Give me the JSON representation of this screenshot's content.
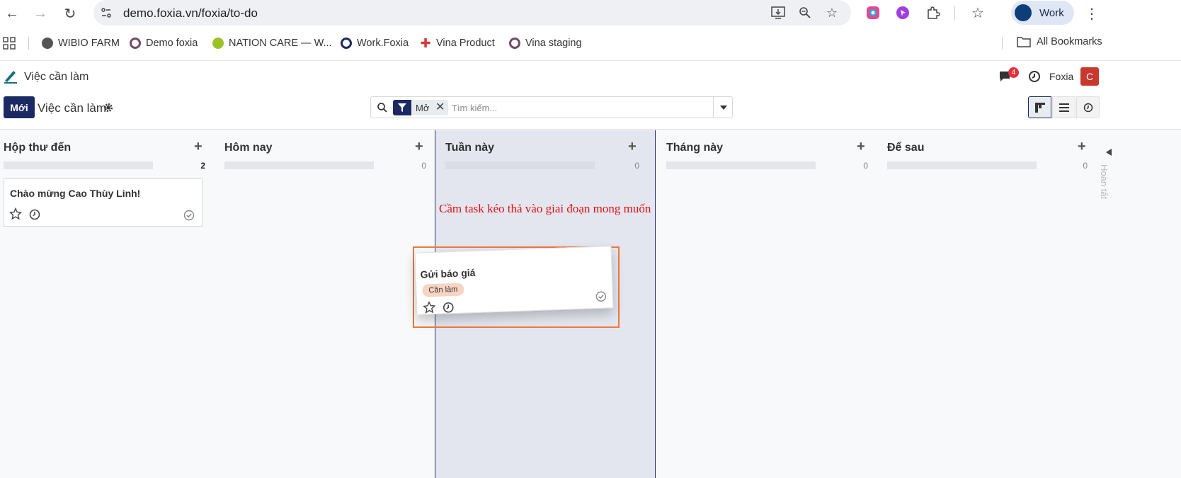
{
  "browser": {
    "url": "demo.foxia.vn/foxia/to-do",
    "profile_label": "Work"
  },
  "bookmarks": {
    "items": [
      {
        "label": "WIBIO FARM",
        "color": "#555555"
      },
      {
        "label": "Demo foxia",
        "color": "#714b67"
      },
      {
        "label": "NATION CARE — W...",
        "color": "#9ac227"
      },
      {
        "label": "Work.Foxia",
        "color": "#1b2a63"
      },
      {
        "label": "Vina Product",
        "color": "#d33b3b"
      },
      {
        "label": "Vina staging",
        "color": "#714b67"
      }
    ],
    "all_label": "All Bookmarks"
  },
  "app": {
    "title": "Việc cần làm",
    "chat_count": "4",
    "company": "Foxia",
    "user_initial": "C"
  },
  "control": {
    "new_label": "Mới",
    "breadcrumb": "Việc cần làm",
    "filter_chip": "Mở",
    "search_placeholder": "Tìm kiếm..."
  },
  "kanban": {
    "columns": [
      {
        "title": "Hộp thư đến",
        "count": "2"
      },
      {
        "title": "Hôm nay",
        "count": "0"
      },
      {
        "title": "Tuần này",
        "count": "0"
      },
      {
        "title": "Tháng này",
        "count": "0"
      },
      {
        "title": "Để sau",
        "count": "0"
      }
    ],
    "folded_column_label": "Hoàn tất",
    "cards": [
      {
        "title": "Chào mừng Cao Thùy Linh!"
      }
    ],
    "dragged_card": {
      "title": "Gửi báo giá",
      "tag": "Cần làm"
    },
    "annotation": "Cầm task kéo thả vào giai đoạn mong muốn"
  },
  "colors": {
    "brand": "#1b2a63",
    "annotation": "#e01010",
    "drag_outline": "#ee7a3b",
    "avatar": "#c8382e"
  }
}
